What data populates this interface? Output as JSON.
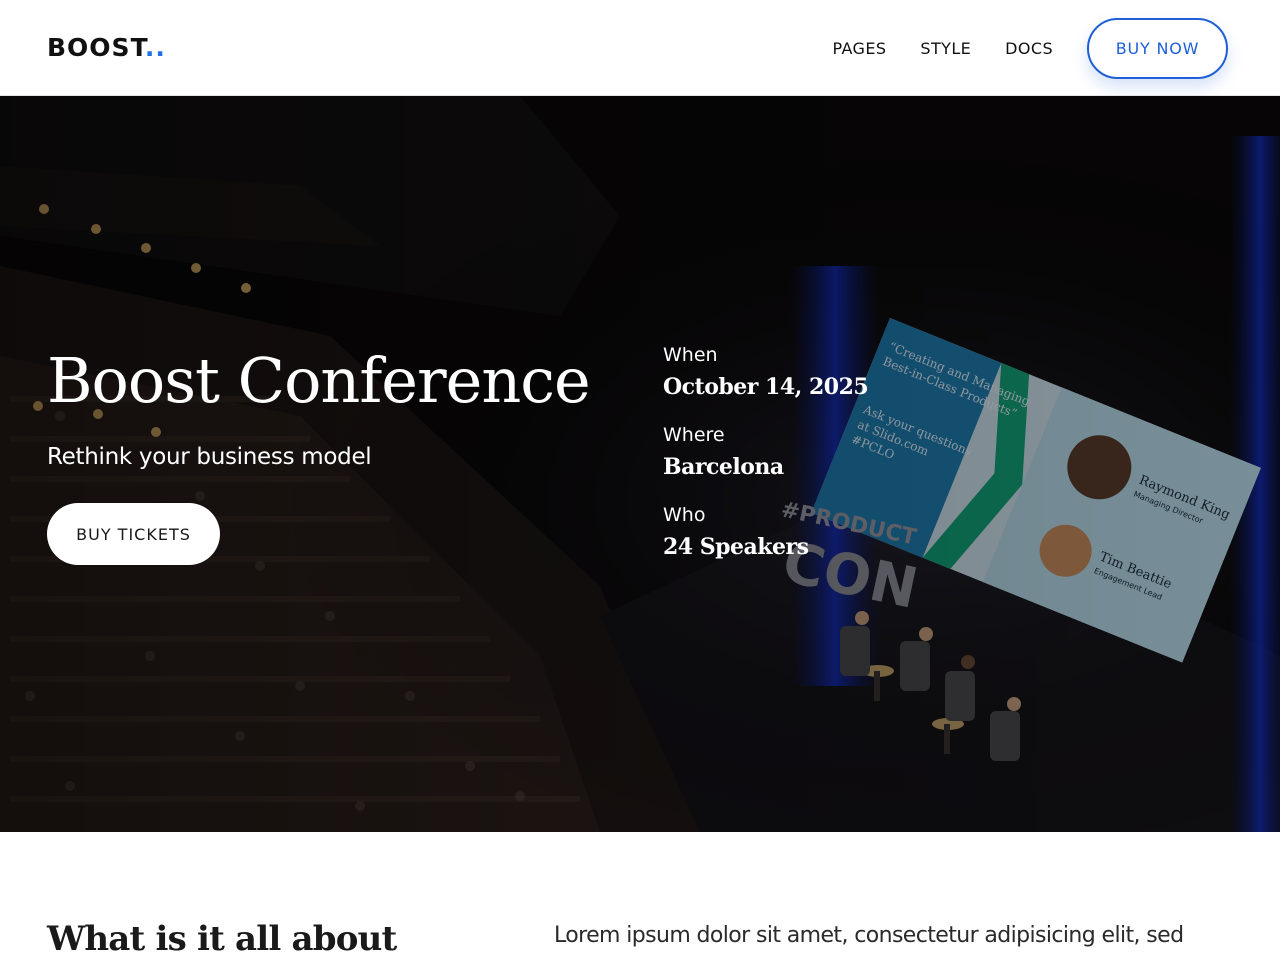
{
  "header": {
    "logo_text": "BOOST",
    "logo_dots": "..",
    "nav": [
      {
        "label": "PAGES"
      },
      {
        "label": "STYLE"
      },
      {
        "label": "DOCS"
      }
    ],
    "cta_label": "BUY NOW"
  },
  "hero": {
    "title": "Boost Conference",
    "subtitle": "Rethink your business model",
    "button_label": "BUY TICKETS",
    "info": [
      {
        "label": "When",
        "value": "October 14, 2025"
      },
      {
        "label": "Where",
        "value": "Barcelona"
      },
      {
        "label": "Who",
        "value": "24 Speakers"
      }
    ],
    "screen_text": {
      "quote": "“Creating and Managing Best-in-Class Products”",
      "ask": "Ask your questions at Slido.com #PCLO",
      "speaker1_name": "Raymond King",
      "speaker1_role": "Managing Director",
      "speaker2_name": "Tim Beattie",
      "speaker2_role": "Engagement Lead",
      "stage_sign": "#PRODUCT CON"
    }
  },
  "about": {
    "heading": "What is it all about",
    "text": "Lorem ipsum dolor sit amet, consectetur adipisicing elit, sed"
  },
  "colors": {
    "accent": "#1e5fd8",
    "hero_bg": "#0a0808"
  }
}
